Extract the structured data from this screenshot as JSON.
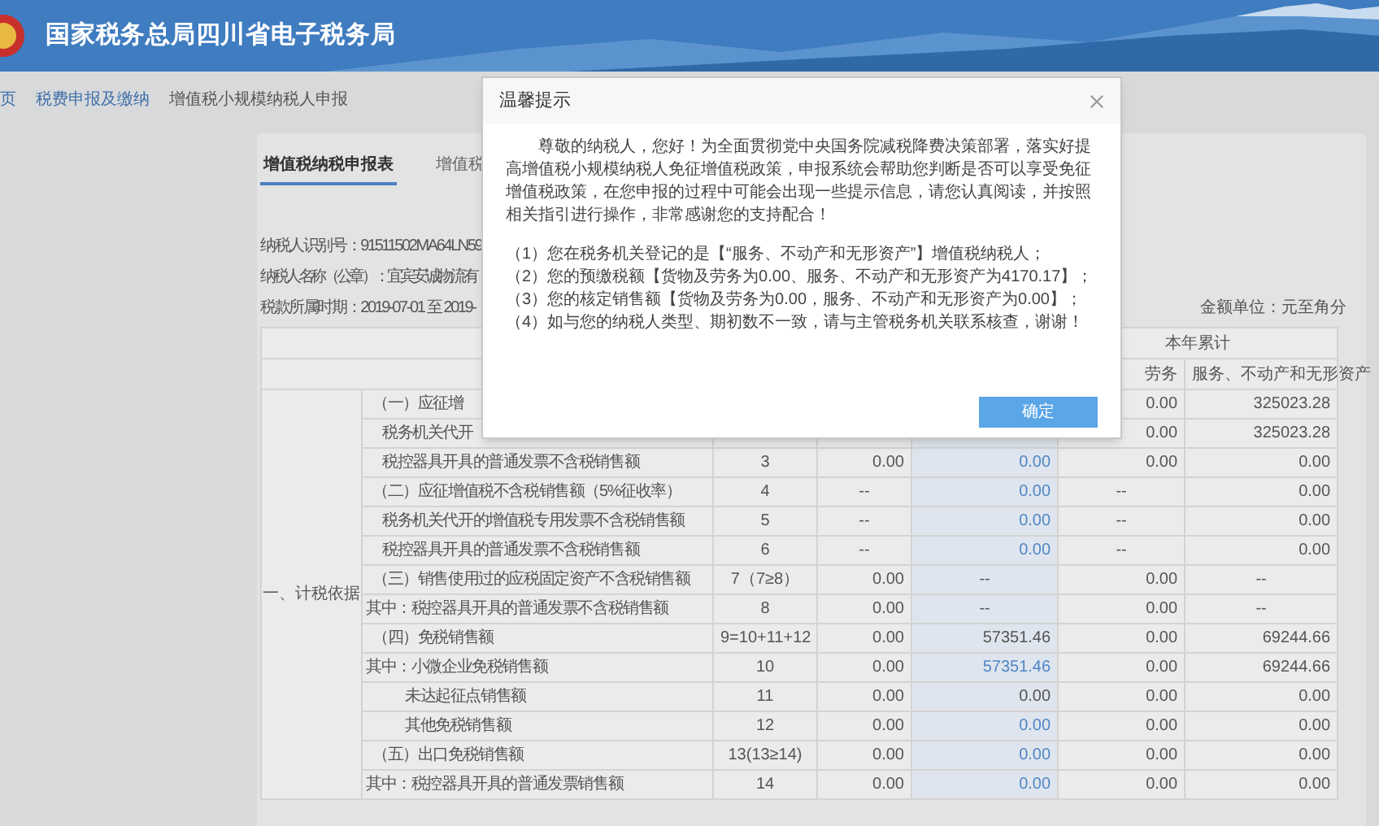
{
  "header": {
    "title": "国家税务总局四川省电子税务局"
  },
  "breadcrumb": [
    {
      "label": "页",
      "kind": "link"
    },
    {
      "label": "税费申报及缴纳",
      "kind": "link"
    },
    {
      "label": "增值税小规模纳税人申报",
      "kind": "current"
    }
  ],
  "tabs": [
    {
      "label": "增值税纳税申报表",
      "selected": true
    },
    {
      "label": "增值税",
      "selected": false
    }
  ],
  "taxpayer_info": [
    "纳税人识别号：91511502MA64LN59",
    "纳税人名称（公章）：宜宾安诚物流有",
    "税款所属时期：2019-07-01 至 2019-"
  ],
  "amount_unit": "金额单位：元至角分",
  "table": {
    "section_label": "一、计税依据",
    "header_group": "本年累计",
    "header_columns": [
      "劳务",
      "服务、不动产和无形资产"
    ],
    "rows": [
      {
        "kind": "heading",
        "item": "（一）应征增",
        "goods_ytd": "0.00",
        "service_ytd": "325023.28"
      },
      {
        "kind": "item",
        "item": "税务机关代开",
        "goods_ytd": "0.00",
        "service_ytd": "325023.28"
      },
      {
        "kind": "item",
        "item": "税控器具开具的普通发票不含税销售额",
        "line": "3",
        "goods_current": "0.00",
        "service_current": "0.00",
        "service_editable": true,
        "goods_ytd": "0.00",
        "service_ytd": "0.00"
      },
      {
        "kind": "heading",
        "item": "（二）应征增值税不含税销售额（5%征收率）",
        "line": "4",
        "goods_current": "--",
        "service_current": "0.00",
        "service_editable": true,
        "goods_ytd": "--",
        "service_ytd": "0.00"
      },
      {
        "kind": "item",
        "item": "税务机关代开的增值税专用发票不含税销售额",
        "line": "5",
        "goods_current": "--",
        "service_current": "0.00",
        "service_editable": true,
        "goods_ytd": "--",
        "service_ytd": "0.00"
      },
      {
        "kind": "item",
        "item": "税控器具开具的普通发票不含税销售额",
        "line": "6",
        "goods_current": "--",
        "service_current": "0.00",
        "service_editable": true,
        "goods_ytd": "--",
        "service_ytd": "0.00"
      },
      {
        "kind": "heading",
        "item": "（三）销售使用过的应税固定资产不含税销售额",
        "line": "7（7≥8）",
        "goods_current": "0.00",
        "service_current": "--",
        "service_editable": false,
        "goods_ytd": "0.00",
        "service_ytd": "--"
      },
      {
        "kind": "note",
        "item": "其中：税控器具开具的普通发票不含税销售额",
        "line": "8",
        "goods_current": "0.00",
        "service_current": "--",
        "service_editable": false,
        "goods_ytd": "0.00",
        "service_ytd": "--"
      },
      {
        "kind": "heading",
        "item": "（四）免税销售额",
        "line": "9=10+11+12",
        "goods_current": "0.00",
        "service_current": "57351.46",
        "service_editable": false,
        "goods_ytd": "0.00",
        "service_ytd": "69244.66"
      },
      {
        "kind": "note",
        "item": "其中：小微企业免税销售额",
        "line": "10",
        "goods_current": "0.00",
        "service_current": "57351.46",
        "service_editable": true,
        "goods_ytd": "0.00",
        "service_ytd": "69244.66"
      },
      {
        "kind": "sub",
        "item": "未达起征点销售额",
        "line": "11",
        "goods_current": "0.00",
        "service_current": "0.00",
        "service_editable": false,
        "goods_ytd": "0.00",
        "service_ytd": "0.00"
      },
      {
        "kind": "sub",
        "item": "其他免税销售额",
        "line": "12",
        "goods_current": "0.00",
        "service_current": "0.00",
        "service_editable": true,
        "goods_ytd": "0.00",
        "service_ytd": "0.00"
      },
      {
        "kind": "heading",
        "item": "（五）出口免税销售额",
        "line": "13(13≥14)",
        "goods_current": "0.00",
        "service_current": "0.00",
        "service_editable": true,
        "goods_ytd": "0.00",
        "service_ytd": "0.00"
      },
      {
        "kind": "note",
        "item": "其中：税控器具开具的普通发票销售额",
        "line": "14",
        "goods_current": "0.00",
        "service_current": "0.00",
        "service_editable": true,
        "goods_ytd": "0.00",
        "service_ytd": "0.00"
      }
    ]
  },
  "dialog": {
    "title": "温馨提示",
    "message": "尊敬的纳税人，您好！为全面贯彻党中央国务院减税降费决策部署，落实好提高增值税小规模纳税人免征增值税政策，申报系统会帮助您判断是否可以享受免征增值税政策，在您申报的过程中可能会出现一些提示信息，请您认真阅读，并按照相关指引进行操作，非常感谢您的支持配合！",
    "notes": [
      "（1）您在税务机关登记的是【“服务、不动产和无形资产”】增值税纳税人；",
      "（2）您的预缴税额【货物及劳务为0.00、服务、不动产和无形资产为4170.17】；",
      "（3）您的核定销售额【货物及劳务为0.00，服务、不动产和无形资产为0.00】；",
      "（4）如与您的纳税人类型、期初数不一致，请与主管税务机关联系核查，谢谢！"
    ],
    "confirm": "确定"
  }
}
